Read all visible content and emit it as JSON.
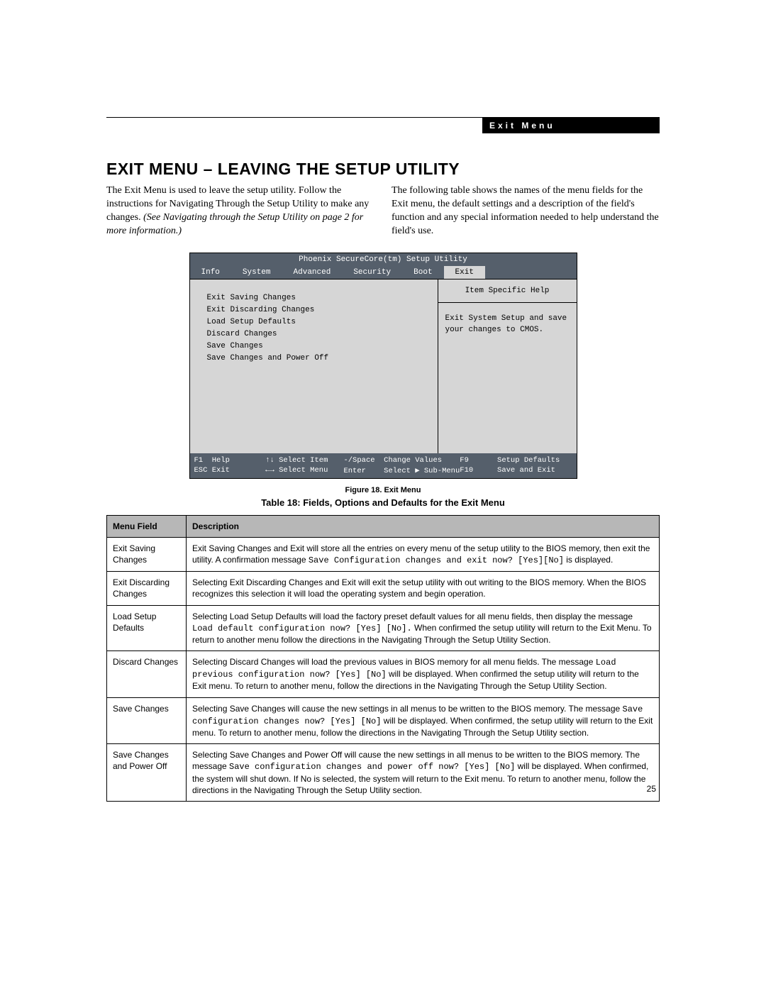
{
  "header": {
    "section_label": "Exit Menu",
    "page_number": "25"
  },
  "title": "EXIT MENU – LEAVING THE SETUP UTILITY",
  "intro": {
    "left_1": "The Exit Menu is used to leave the setup utility. Follow the instructions for Navigating Through the Setup Utility to make any changes. ",
    "left_italic": "(See Navigating through the Setup Utility on page 2 for more information.)",
    "right": "The following table shows the names of the menu fields for the Exit menu, the default settings and a description of the field's function and any special information needed to help understand the field's use."
  },
  "bios": {
    "title": "Phoenix SecureCore(tm) Setup Utility",
    "tabs": [
      "Info",
      "System",
      "Advanced",
      "Security",
      "Boot",
      "Exit"
    ],
    "active_tab": "Exit",
    "menu_items": [
      "Exit Saving Changes",
      "Exit Discarding Changes",
      "Load Setup Defaults",
      "Discard Changes",
      "Save Changes",
      "Save Changes and Power Off"
    ],
    "help_panel_title": "Item Specific Help",
    "help_panel_body": "Exit System Setup and save your changes to CMOS.",
    "footer": {
      "r1c1": "F1  Help",
      "r1c2": "↑↓ Select Item",
      "r1c3": "-/Space  Change Values",
      "r1c4": "F9",
      "r1c5": "Setup Defaults",
      "r2c1": "ESC Exit",
      "r2c2": "←→ Select Menu",
      "r2c3": "Enter    Select ▶ Sub-Menu",
      "r2c4": "F10",
      "r2c5": "Save and Exit"
    }
  },
  "figure_caption": "Figure 18.  Exit Menu",
  "table_caption": "Table 18: Fields, Options and Defaults for the Exit Menu",
  "table": {
    "col1": "Menu Field",
    "col2": "Description",
    "rows": [
      {
        "field": "Exit Saving Changes",
        "desc_pre": "Exit Saving Changes and Exit will store all the entries on every menu of the setup utility to the BIOS memory, then exit the utility. A confirmation message ",
        "desc_mono": "Save Configuration changes and exit now? [Yes][No]",
        "desc_post": " is displayed."
      },
      {
        "field": "Exit Discarding Changes",
        "desc_pre": "Selecting Exit Discarding Changes and Exit will exit the setup utility with out writing to the BIOS memory. When the BIOS recognizes this selection it will load the operating system and begin operation.",
        "desc_mono": "",
        "desc_post": ""
      },
      {
        "field": "Load Setup Defaults",
        "desc_pre": "Selecting Load Setup Defaults will load the factory preset default values for all menu fields, then display the message ",
        "desc_mono": "Load default configuration now? [Yes] [No].",
        "desc_post": " When confirmed the setup utility will return to the Exit Menu. To return to another menu follow the directions in the Navigating Through the Setup Utility Section."
      },
      {
        "field": "Discard Changes",
        "desc_pre": "Selecting Discard Changes will load the previous values in BIOS memory for all menu fields. The message ",
        "desc_mono": "Load previous configuration now? [Yes] [No]",
        "desc_post": " will be displayed. When confirmed the setup utility will return to the Exit menu. To return to another menu, follow the directions in the Navigating Through the Setup Utility Section."
      },
      {
        "field": "Save Changes",
        "desc_pre": "Selecting Save Changes will cause the new settings in all menus to be written to the BIOS memory. The message ",
        "desc_mono": "Save configuration changes now? [Yes] [No]",
        "desc_post": " will be displayed. When confirmed, the setup utility will return to the Exit menu. To return to another menu, follow the directions in the Navigating Through the Setup Utility section."
      },
      {
        "field": "Save Changes and Power Off",
        "desc_pre": "Selecting Save Changes and Power Off will cause the new settings in all menus to be written to the BIOS memory. The message ",
        "desc_mono": "Save configuration changes and power off now? [Yes] [No]",
        "desc_post": " will be displayed. When confirmed, the system will shut down. If No is selected, the system will return to the Exit menu. To return to another menu, follow the directions in the Navigating Through the Setup Utility section."
      }
    ]
  }
}
